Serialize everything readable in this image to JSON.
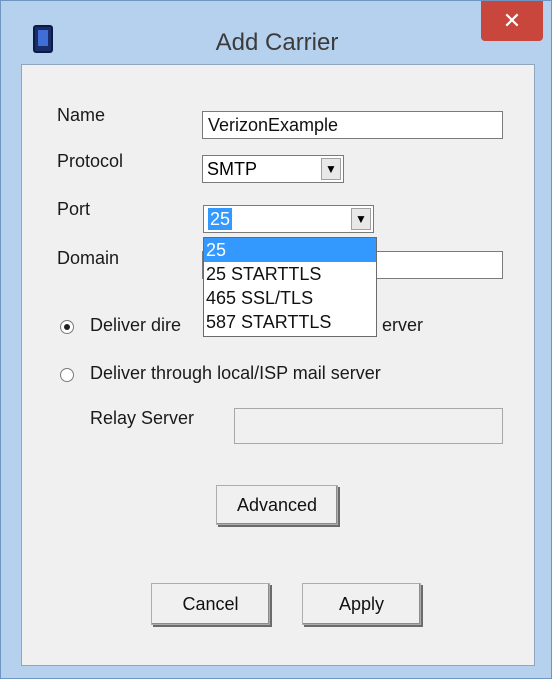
{
  "window": {
    "title": "Add Carrier",
    "close": "✕"
  },
  "form": {
    "name_label": "Name",
    "name_value": "VerizonExample",
    "protocol_label": "Protocol",
    "protocol_value": "SMTP",
    "port_label": "Port",
    "port_value": "25",
    "domain_label": "Domain",
    "domain_value": "",
    "radio_direct_label": "Deliver dire",
    "radio_direct_tail": "erver",
    "radio_relay_label": "Deliver through local/ISP mail server",
    "relay_label": "Relay Server",
    "relay_value": "",
    "dropdown_glyph": "▼"
  },
  "port_options": [
    "25",
    "25 STARTTLS",
    "465 SSL/TLS",
    "587 STARTTLS"
  ],
  "buttons": {
    "advanced": "Advanced",
    "cancel": "Cancel",
    "apply": "Apply"
  }
}
